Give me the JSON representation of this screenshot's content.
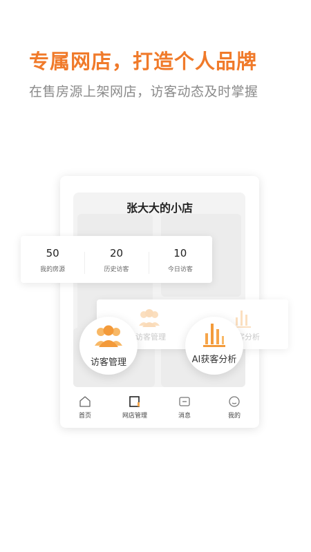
{
  "hero": {
    "title": "专属网店，打造个人品牌",
    "subtitle": "在售房源上架网店，访客动态及时掌握"
  },
  "store": {
    "title": "张大大的小店"
  },
  "stats": [
    {
      "value": "50",
      "label": "我的房源"
    },
    {
      "value": "20",
      "label": "历史访客"
    },
    {
      "value": "10",
      "label": "今日访客"
    }
  ],
  "ghost": {
    "left_label": "访客管理",
    "right_label": "客分析"
  },
  "features": {
    "visitor_label": "访客管理",
    "ai_label": "AI获客分析"
  },
  "tabs": [
    {
      "label": "首页",
      "icon": "home-icon"
    },
    {
      "label": "网店管理",
      "icon": "store-icon"
    },
    {
      "label": "消息",
      "icon": "message-icon"
    },
    {
      "label": "我的",
      "icon": "profile-icon"
    }
  ],
  "colors": {
    "accent": "#f07a2a",
    "icon_orange": "#f6a54a",
    "subtitle": "#8a8a8a"
  }
}
